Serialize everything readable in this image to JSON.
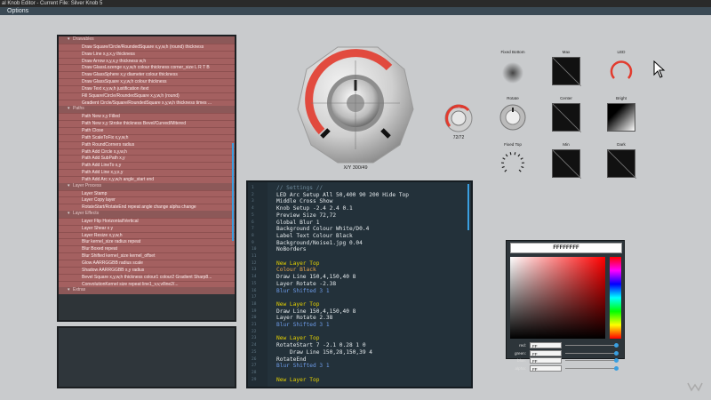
{
  "window": {
    "title": "al Knob Editor - Current File: Silver Knob 5"
  },
  "menu": {
    "options": "Options"
  },
  "tree": {
    "rows": [
      {
        "kind": "group",
        "label": "Drawables"
      },
      {
        "kind": "item",
        "label": "Draw Square/Circle/RoundedSquare x,y,w,h (round) thickness"
      },
      {
        "kind": "item",
        "label": "Draw Line x,y,x,y thickness"
      },
      {
        "kind": "item",
        "label": "Draw Arrow x,y,x,y thickness w,h"
      },
      {
        "kind": "item",
        "label": "Draw GlassLozenge x,y,w,h colour thickness corner_size L R T B"
      },
      {
        "kind": "item",
        "label": "Draw GlassSphere x,y diameter colour thickness"
      },
      {
        "kind": "item",
        "label": "Draw GlassSquare x,y,w,h colour thickness"
      },
      {
        "kind": "item",
        "label": "Draw Text x,y,w,h justification /text"
      },
      {
        "kind": "item",
        "label": "Fill Square/Circle/RoundedSquare x,y,w,h (round)"
      },
      {
        "kind": "item",
        "label": "Gradient Circle/Square/RoundedSquare x,y,w,h thickness times ..."
      },
      {
        "kind": "group",
        "label": "Paths"
      },
      {
        "kind": "item",
        "label": "Path New x,y Filled"
      },
      {
        "kind": "item",
        "label": "Path New x,y Stroke thickness Bevel/Curved/Mitered"
      },
      {
        "kind": "item",
        "label": "Path Close"
      },
      {
        "kind": "item",
        "label": "Path ScaleToFix x,y,w,h"
      },
      {
        "kind": "item",
        "label": "Path RoundCorners radius"
      },
      {
        "kind": "item",
        "label": "Path Add Circle x,y,w,h"
      },
      {
        "kind": "item",
        "label": "Path Add SubPath x,y"
      },
      {
        "kind": "item",
        "label": "Path Add LineTo x,y"
      },
      {
        "kind": "item",
        "label": "Path Add Line x,y,x,y"
      },
      {
        "kind": "item",
        "label": "Path Add Arc x,y,w,h angle_start end"
      },
      {
        "kind": "group",
        "label": "Layer Process"
      },
      {
        "kind": "item",
        "label": "Layer Stamp"
      },
      {
        "kind": "item",
        "label": "Layer Copy layer"
      },
      {
        "kind": "item",
        "label": "RotateStart/RotateEnd repeat angle change alpha change"
      },
      {
        "kind": "group",
        "label": "Layer Effects"
      },
      {
        "kind": "item",
        "label": "Layer Flip Horizontal/Vertical"
      },
      {
        "kind": "item",
        "label": "Layer Shear x y"
      },
      {
        "kind": "item",
        "label": "Layer Resize x,y,w,h"
      },
      {
        "kind": "item",
        "label": "Blur kernel_size radius repeat"
      },
      {
        "kind": "item",
        "label": "Blur Boxed repeat"
      },
      {
        "kind": "item",
        "label": "Blur Shifted kernel_size kernel_offset"
      },
      {
        "kind": "item",
        "label": "Glow AARRGGBB radius scale"
      },
      {
        "kind": "item",
        "label": "Shadow AARRGGBB x,y radius"
      },
      {
        "kind": "item",
        "label": "Bevel Square x,y,w,h thickness colour1 colour2 Gradient Sharp8..."
      },
      {
        "kind": "item",
        "label": "ConvolutionKernel size repeat line1_v,v,v/line2/..."
      },
      {
        "kind": "group",
        "label": "Extras"
      }
    ]
  },
  "editor": {
    "lines": [
      {
        "n": "1",
        "text": "// Settings //",
        "style": "comment"
      },
      {
        "n": "2",
        "text": "LED Arc Setup All 50,400 90 200 Hide Top",
        "style": "plain"
      },
      {
        "n": "3",
        "text": "Middle Cross Show",
        "style": "plain"
      },
      {
        "n": "4",
        "text": "Knob Setup -2.4 2.4 0.1",
        "style": "plain"
      },
      {
        "n": "5",
        "text": "Preview Size 72,72",
        "style": "plain"
      },
      {
        "n": "6",
        "text": "Global Blur 1",
        "style": "plain"
      },
      {
        "n": "7",
        "text": "Background Colour White/D0.4",
        "style": "plain"
      },
      {
        "n": "8",
        "text": "Label Text Colour Black",
        "style": "plain"
      },
      {
        "n": "9",
        "text": "Background/Noise1.jpg 0.04",
        "style": "plain"
      },
      {
        "n": "10",
        "text": "NoBorders",
        "style": "plain"
      },
      {
        "n": "11",
        "text": "",
        "style": "plain"
      },
      {
        "n": "12",
        "text": "New Layer Top",
        "style": "yellow"
      },
      {
        "n": "13",
        "text": "Colour Black",
        "style": "orange"
      },
      {
        "n": "14",
        "text": "Draw Line 150,4,150,40 8",
        "style": "plain"
      },
      {
        "n": "15",
        "text": "Layer Rotate -2.38",
        "style": "plain"
      },
      {
        "n": "16",
        "text": "Blur Shifted 3 1",
        "style": "blue"
      },
      {
        "n": "17",
        "text": "",
        "style": "plain"
      },
      {
        "n": "18",
        "text": "New Layer Top",
        "style": "yellow"
      },
      {
        "n": "19",
        "text": "Draw Line 150,4,150,40 8",
        "style": "plain"
      },
      {
        "n": "20",
        "text": "Layer Rotate 2.38",
        "style": "plain"
      },
      {
        "n": "21",
        "text": "Blur Shifted 3 1",
        "style": "blue"
      },
      {
        "n": "22",
        "text": "",
        "style": "plain"
      },
      {
        "n": "23",
        "text": "New Layer Top",
        "style": "yellow"
      },
      {
        "n": "24",
        "text": "RotateStart 7 -2.1 0.28 1 0",
        "style": "plain"
      },
      {
        "n": "25",
        "text": "    Draw Line 150,28,150,39 4",
        "style": "plain"
      },
      {
        "n": "26",
        "text": "RotateEnd",
        "style": "plain"
      },
      {
        "n": "27",
        "text": "Blur Shifted 3 1",
        "style": "blue"
      },
      {
        "n": "28",
        "text": "",
        "style": "plain"
      },
      {
        "n": "29",
        "text": "New Layer Top",
        "style": "yellow"
      }
    ]
  },
  "preview": {
    "main_caption": "X/Y 300/49",
    "mini_caption": "72/72",
    "mini_label": "Knob Label"
  },
  "tiles": {
    "fixed_bottom": "Fixed Bottom",
    "max": "Max",
    "led": "LED",
    "rotate": "Rotate",
    "center": "Center",
    "bright": "Bright",
    "fixed_top": "Fixed Top",
    "min": "Min",
    "dark": "Dark"
  },
  "picker": {
    "hex": "FFFFFFFF",
    "rows": [
      {
        "label": "red:",
        "value": "FF"
      },
      {
        "label": "green:",
        "value": "FF"
      },
      {
        "label": "blue:",
        "value": "FF"
      },
      {
        "label": "alpha:",
        "value": "FF"
      }
    ]
  },
  "colors": {
    "accent_red": "#e23b2e",
    "selection_blue": "#3a9fe0",
    "tree_item_bg": "#a46060"
  }
}
